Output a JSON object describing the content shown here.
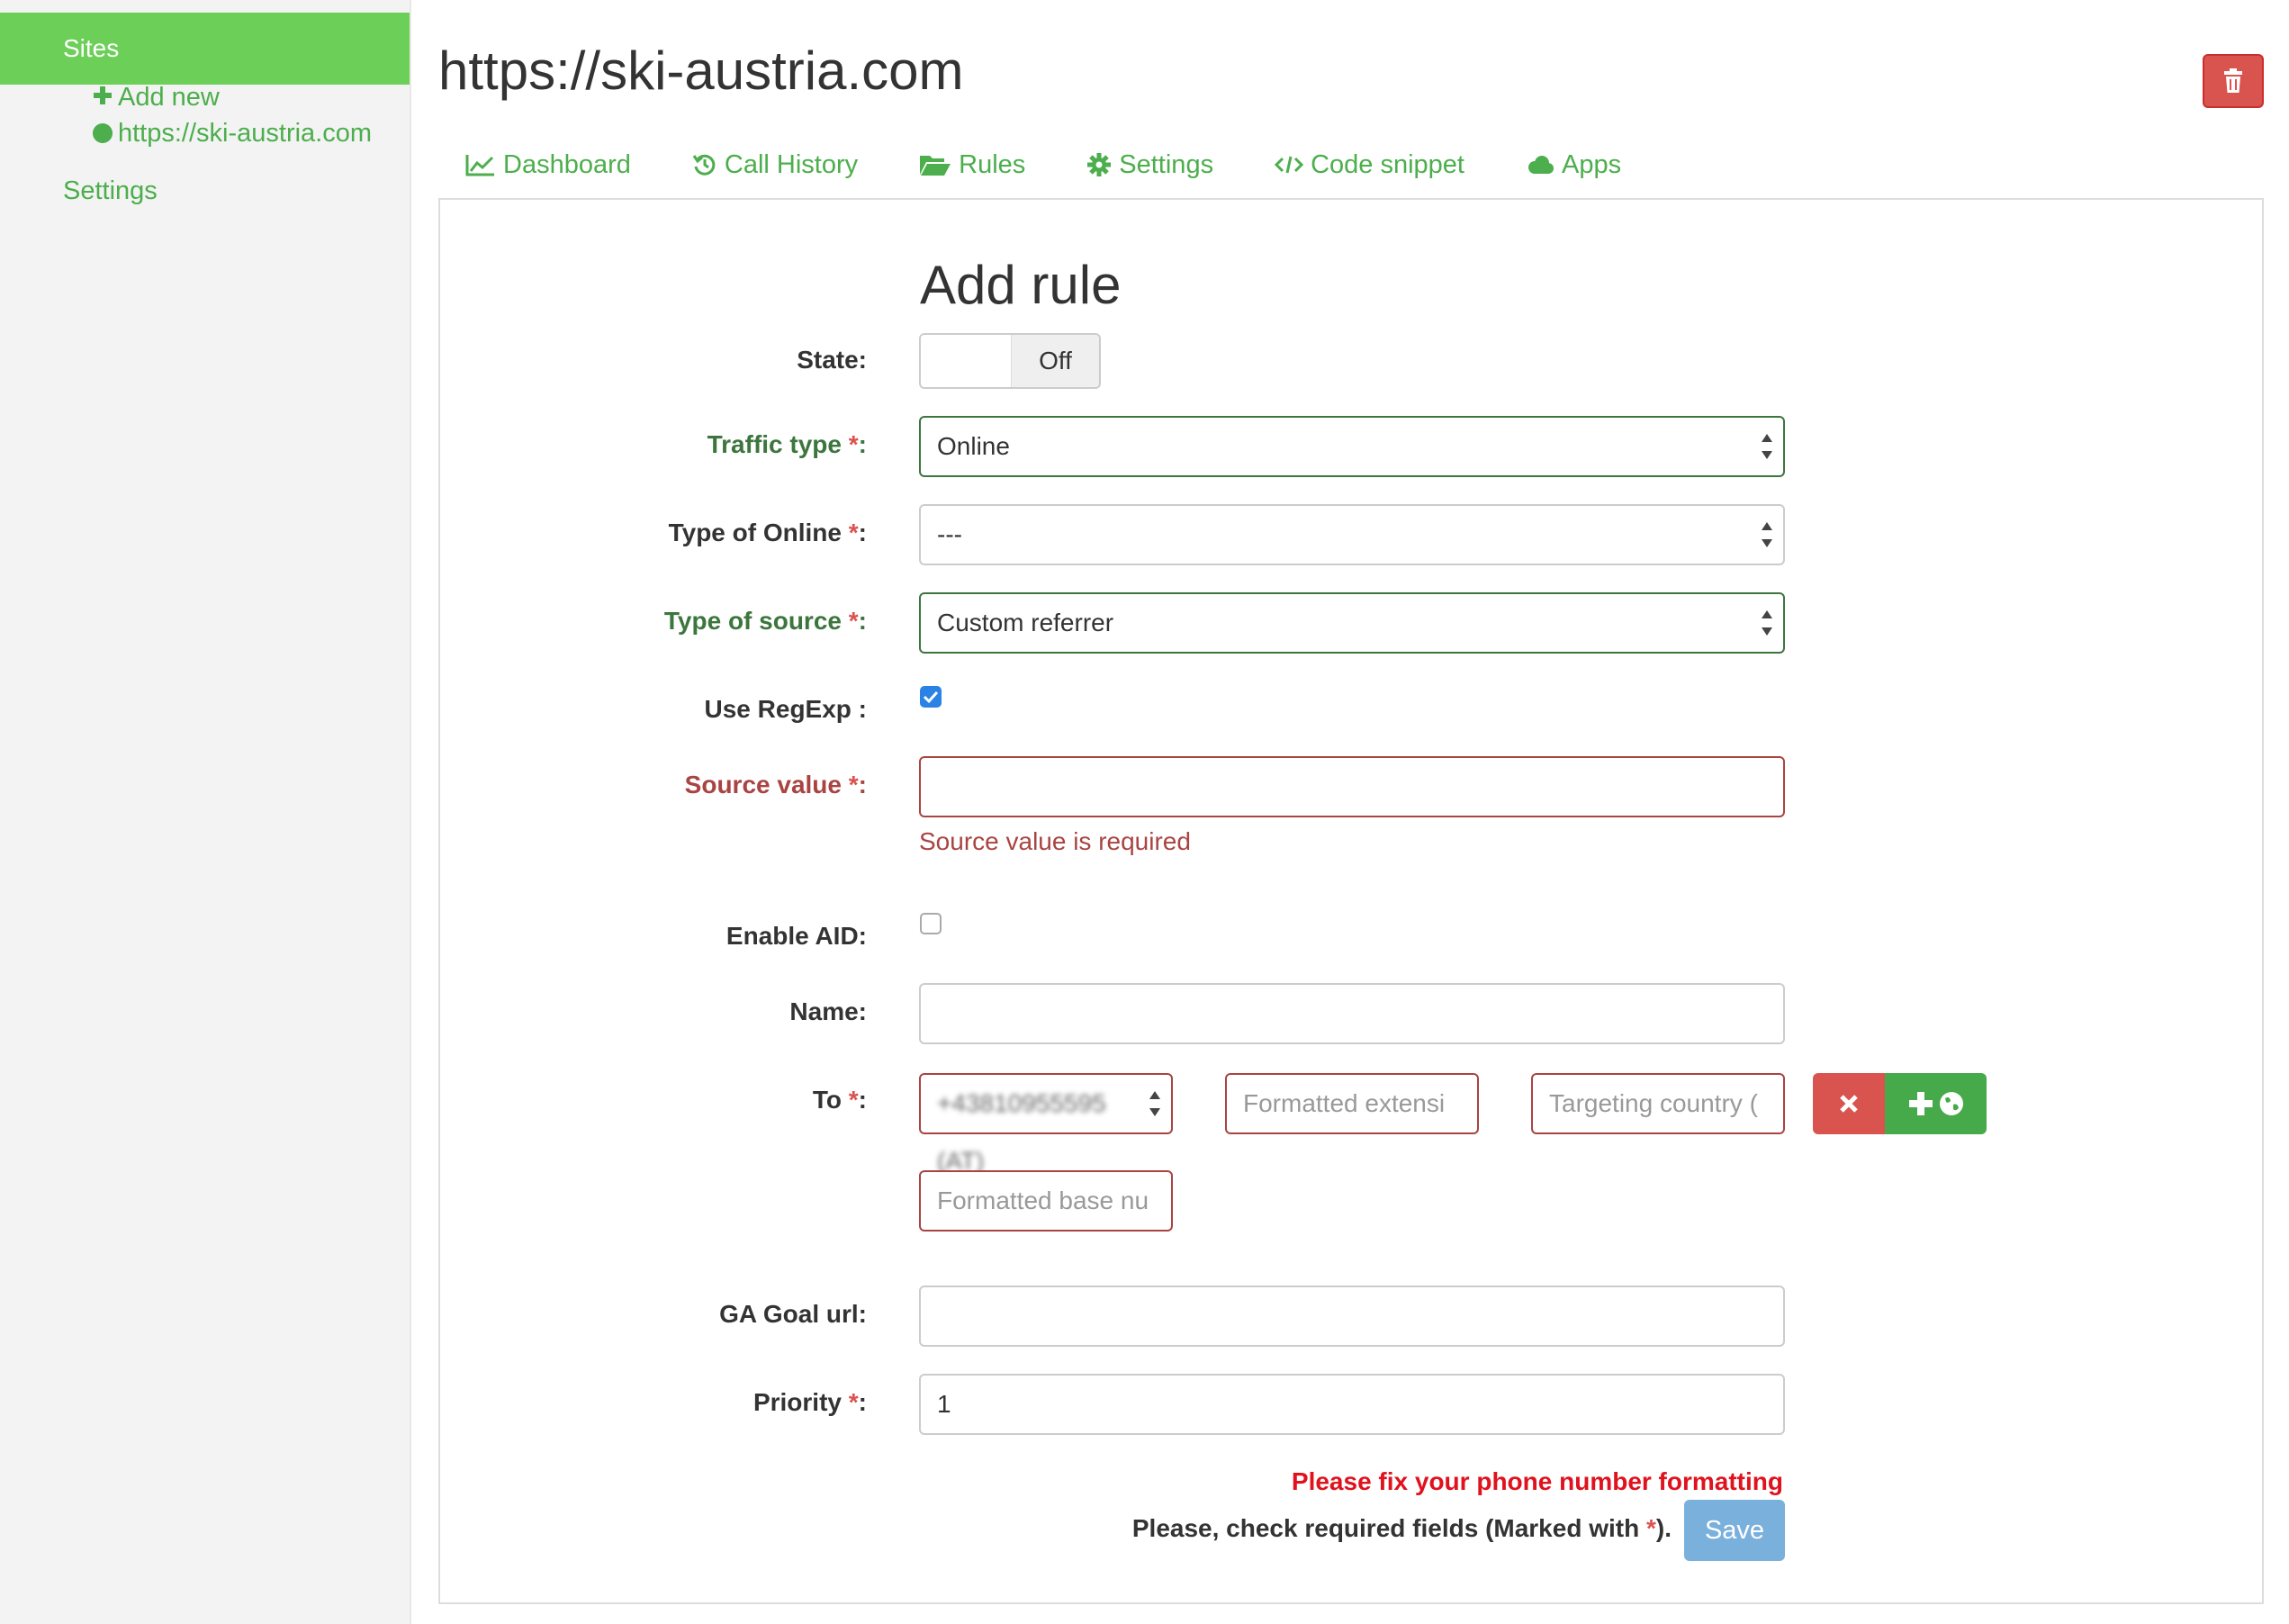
{
  "sidebar": {
    "sites_label": "Sites",
    "add_new_label": "Add new",
    "site_label": "https://ski-austria.com",
    "settings_label": "Settings"
  },
  "header": {
    "title": "https://ski-austria.com"
  },
  "tabs": [
    {
      "label": "Dashboard",
      "icon": "line-chart-icon"
    },
    {
      "label": "Call History",
      "icon": "history-icon"
    },
    {
      "label": "Rules",
      "icon": "folder-open-icon"
    },
    {
      "label": "Settings",
      "icon": "gear-icon"
    },
    {
      "label": "Code snippet",
      "icon": "code-icon"
    },
    {
      "label": "Apps",
      "icon": "cloud-icon"
    }
  ],
  "form": {
    "title": "Add rule",
    "state": {
      "label": "State:",
      "toggle_text": "Off"
    },
    "traffic_type": {
      "label": "Traffic type",
      "value": "Online"
    },
    "type_of_online": {
      "label": "Type of Online",
      "value": "---"
    },
    "type_of_source": {
      "label": "Type of source",
      "value": "Custom referrer"
    },
    "use_regexp": {
      "label": "Use RegExp :",
      "checked": true
    },
    "source_value": {
      "label": "Source value",
      "value": "",
      "error": "Source value is required"
    },
    "enable_aid": {
      "label": "Enable AID:",
      "checked": false
    },
    "name": {
      "label": "Name:",
      "value": ""
    },
    "to": {
      "label": "To",
      "number_value": "+43810955595 (AT)",
      "formatted_extension_placeholder": "Formatted extensi",
      "targeting_country_placeholder": "Targeting country (",
      "formatted_base_placeholder": "Formatted base nu"
    },
    "ga_goal_url": {
      "label": "GA Goal url:",
      "value": ""
    },
    "priority": {
      "label": "Priority",
      "value": "1"
    },
    "required_mark": "*",
    "colon": ":",
    "warning": "Please fix your phone number formatting",
    "check_note_prefix": "Please, check required fields (Marked with ",
    "check_note_suffix": ").",
    "save_label": "Save"
  },
  "colors": {
    "accent": "#6ccf58",
    "link": "#4cae4c",
    "error": "#a94442",
    "warning": "#e0121d",
    "success_label": "#3c763d",
    "delete_button": "#d9534f",
    "save_button": "#7ab0dc"
  }
}
